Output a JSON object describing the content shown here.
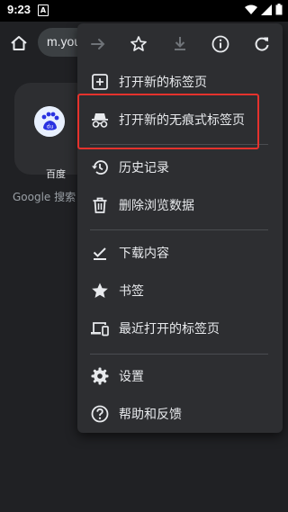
{
  "status_bar": {
    "time": "9:23",
    "notif_letter": "A"
  },
  "toolbar": {
    "url": "m.you"
  },
  "new_tab_page": {
    "tile_label": "百度",
    "search_hint": "Google 搜索"
  },
  "menu": {
    "items": [
      {
        "label": "打开新的标签页",
        "icon": "plus-box-icon"
      },
      {
        "label": "打开新的无痕式标签页",
        "icon": "incognito-icon"
      },
      {
        "label": "历史记录",
        "icon": "history-icon"
      },
      {
        "label": "删除浏览数据",
        "icon": "trash-icon"
      },
      {
        "label": "下载内容",
        "icon": "download-done-icon"
      },
      {
        "label": "书签",
        "icon": "star-icon"
      },
      {
        "label": "最近打开的标签页",
        "icon": "devices-icon"
      },
      {
        "label": "设置",
        "icon": "gear-icon"
      },
      {
        "label": "帮助和反馈",
        "icon": "help-icon"
      }
    ]
  },
  "colors": {
    "background": "#202124",
    "menu": "#2d2e31",
    "highlight": "#e5322d"
  }
}
